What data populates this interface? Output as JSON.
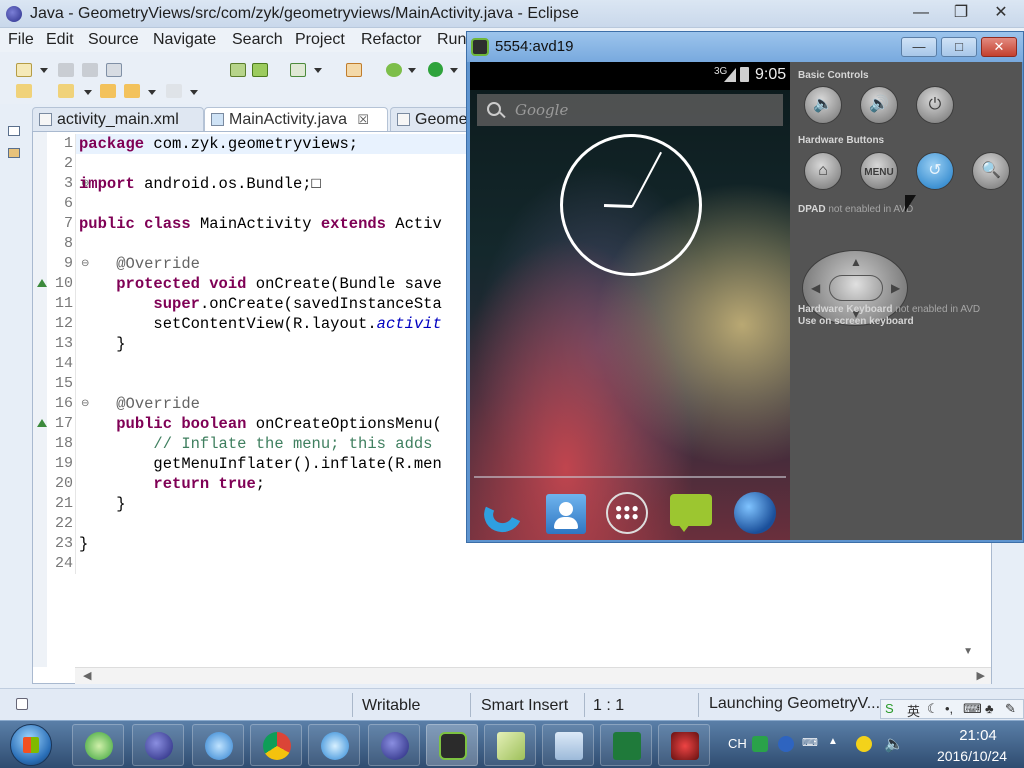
{
  "eclipse": {
    "title": "Java - GeometryViews/src/com/zyk/geometryviews/MainActivity.java - Eclipse",
    "window_buttons": [
      "—",
      "❐",
      "✕"
    ],
    "menu": [
      "File",
      "Edit",
      "Source",
      "Navigate",
      "Search",
      "Project",
      "Refactor",
      "Run"
    ],
    "tabs": [
      {
        "label": "activity_main.xml",
        "close": ""
      },
      {
        "label": "MainActivity.java",
        "close": "☒"
      },
      {
        "label": "Geome",
        "close": ""
      }
    ],
    "line_numbers": [
      "1",
      "2",
      "3",
      "6",
      "7",
      "8",
      "9",
      "10",
      "11",
      "12",
      "13",
      "14",
      "15",
      "16",
      "17",
      "18",
      "19",
      "20",
      "21",
      "22",
      "23",
      "24"
    ],
    "code": {
      "l1_kw": "package",
      "l1_rest": " com.zyk.geometryviews;",
      "l3_kw": "import",
      "l3_rest": " android.os.Bundle;□",
      "l7_kw1": "public",
      "l7_kw2": "class",
      "l7_name": " MainActivity ",
      "l7_kw3": "extends",
      "l7_rest": " Activ",
      "l9_ann": "@Override",
      "l10_kw1": "protected",
      "l10_kw2": "void",
      "l10_rest": " onCreate(Bundle save",
      "l11_kw": "super",
      "l11_rest": ".onCreate(savedInstanceSta",
      "l12_pre": "setContentView(R.layout.",
      "l12_it": "activit",
      "l13": "}",
      "l16_ann": "@Override",
      "l17_kw1": "public",
      "l17_kw2": "boolean",
      "l17_rest": " onCreateOptionsMenu(",
      "l18_cmt": "// Inflate the menu; this adds",
      "l19": "getMenuInflater().inflate(R.men",
      "l20_kw1": "return",
      "l20_kw2": "true",
      "l20_rest": ";",
      "l21": "}",
      "l23": "}"
    },
    "status": {
      "writable": "Writable",
      "insert_mode": "Smart Insert",
      "position": "1 : 1",
      "launching": "Launching GeometryV..."
    }
  },
  "emulator": {
    "title": "5554:avd19",
    "window_buttons": [
      "—",
      "□",
      "✕"
    ],
    "status_clock": "9:05",
    "network": "3G",
    "search_hint": "Google",
    "clock_hour_angle": -178,
    "clock_minute_angle": -62,
    "dock_apps": [
      "phone-icon",
      "people-icon",
      "app-drawer-icon",
      "messaging-icon",
      "browser-icon"
    ],
    "panel": {
      "basic_controls": "Basic Controls",
      "hardware_buttons": "Hardware Buttons",
      "dpad_label": "DPAD",
      "dpad_note": "not enabled in AVD",
      "menu_label": "MENU",
      "keyboard_label": "Hardware Keyboard",
      "keyboard_note": "not enabled in AVD",
      "onscreen_keyboard": "Use on screen keyboard"
    }
  },
  "taskbar": {
    "apps": [
      "ie-icon",
      "eclipse-icon",
      "network-icon",
      "chrome-icon",
      "cloud-icon",
      "eclipse-icon-2",
      "android-emulator-icon",
      "notes-icon",
      "notepad-icon",
      "excel-icon",
      "media-icon"
    ],
    "lang": "CH",
    "time": "21:04",
    "date": "2016/10/24"
  },
  "colors": {
    "keyword": "#7f0055",
    "annotation": "#646464",
    "comment": "#3f7f5f",
    "active_button": "#3b8fd1"
  }
}
